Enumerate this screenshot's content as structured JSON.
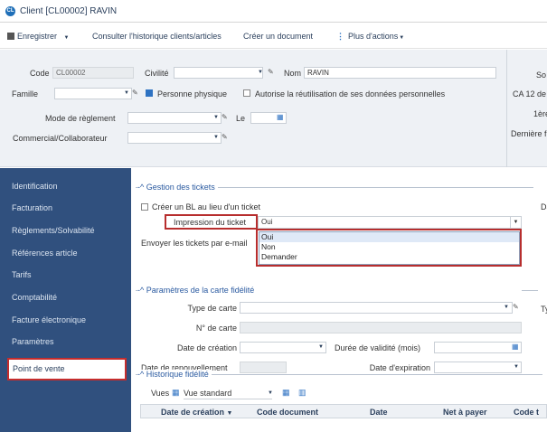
{
  "window": {
    "title": "Client [CL00002] RAVIN",
    "badge": "CL"
  },
  "toolbar": {
    "save_label": "Enregistrer",
    "history_label": "Consulter l'historique clients/articles",
    "create_doc_label": "Créer un document",
    "more_actions_label": "Plus d'actions"
  },
  "header": {
    "code_label": "Code",
    "code_value": "CL00002",
    "civilite_label": "Civilité",
    "civilite_value": "",
    "nom_label": "Nom",
    "nom_value": "RAVIN",
    "famille_label": "Famille",
    "personne_physique_label": "Personne physique",
    "personne_physique_checked": true,
    "autorise_label": "Autorise la réutilisation de ses données personnelles",
    "autorise_checked": false,
    "mode_reglement_label": "Mode de règlement",
    "le_label": "Le",
    "commercial_label": "Commercial/Collaborateur",
    "right_col": [
      "So",
      "CA 12 de",
      "1ère f",
      "Dernière f"
    ]
  },
  "sidebar": {
    "items": [
      {
        "label": "Identification",
        "active": false
      },
      {
        "label": "Facturation",
        "active": false
      },
      {
        "label": "Règlements/Solvabilité",
        "active": false
      },
      {
        "label": "Références article",
        "active": false
      },
      {
        "label": "Tarifs",
        "active": false
      },
      {
        "label": "Comptabilité",
        "active": false
      },
      {
        "label": "Facture électronique",
        "active": false
      },
      {
        "label": "Paramètres",
        "active": false
      },
      {
        "label": "Point de vente",
        "active": true
      }
    ]
  },
  "tickets": {
    "section_title": "Gestion des tickets",
    "create_bl_label": "Créer un BL au lieu d'un ticket",
    "impression_label": "Impression du ticket",
    "impression_value": "Oui",
    "envoyer_label": "Envoyer les tickets par e-mail",
    "options": [
      "Oui",
      "Non",
      "Demander"
    ],
    "right_partial": "Da"
  },
  "fidelite": {
    "section_title": "Paramètres de la carte fidélité",
    "type_carte_label": "Type de carte",
    "num_carte_label": "N° de carte",
    "date_creation_label": "Date de création",
    "duree_label": "Durée de validité (mois)",
    "date_renouv_label": "Date de renouvellement",
    "date_expiration_label": "Date d'expiration",
    "right_partial": "Ty"
  },
  "historique": {
    "section_title": "Historique fidélité",
    "vues_label": "Vues",
    "vue_value": "Vue standard",
    "columns": [
      "Date de création",
      "Code document",
      "Date",
      "Net à payer",
      "Code t"
    ]
  }
}
